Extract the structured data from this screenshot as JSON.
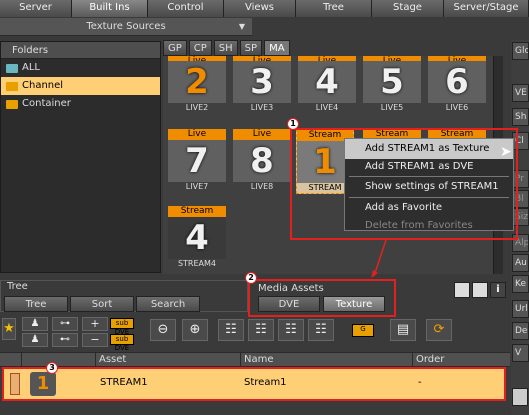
{
  "top_tabs": [
    "Server",
    "Built Ins",
    "Control",
    "Views",
    "Tree",
    "Stage",
    "Server/Stage"
  ],
  "panel": {
    "title": "Texture Sources"
  },
  "folders": {
    "header": "Folders",
    "items": [
      "ALL",
      "Channel",
      "Container"
    ]
  },
  "subtabs": [
    "GP",
    "CP",
    "SH",
    "SP",
    "MA"
  ],
  "assets": [
    {
      "label": "Live",
      "num": "2",
      "caption": "LIVE2",
      "orange": true
    },
    {
      "label": "Live",
      "num": "3",
      "caption": "LIVE3",
      "orange": false
    },
    {
      "label": "Live",
      "num": "4",
      "caption": "LIVE4",
      "orange": false
    },
    {
      "label": "Live",
      "num": "5",
      "caption": "LIVE5",
      "orange": false
    },
    {
      "label": "Live",
      "num": "6",
      "caption": "LIVE6",
      "orange": false
    },
    {
      "label": "Live",
      "num": "7",
      "caption": "LIVE7",
      "orange": false
    },
    {
      "label": "Live",
      "num": "8",
      "caption": "LIVE8",
      "orange": false
    },
    {
      "label": "Stream",
      "num": "1",
      "caption": "STREAM",
      "orange": true
    },
    {
      "label": "Stream",
      "num": "",
      "caption": "",
      "orange": false
    },
    {
      "label": "Stream",
      "num": "",
      "caption": "",
      "orange": false
    },
    {
      "label": "Stream",
      "num": "4",
      "caption": "STREAM4",
      "orange": false
    }
  ],
  "context_menu": {
    "items": [
      "Add STREAM1 as Texture",
      "Add STREAM1 as DVE",
      "Show settings of STREAM1",
      "Add as Favorite",
      "Delete from Favorites"
    ]
  },
  "tree": {
    "header": "Tree",
    "buttons": [
      "Tree",
      "Sort",
      "Search"
    ]
  },
  "media_assets": {
    "header": "Media Assets",
    "buttons": [
      "DVE",
      "Texture"
    ]
  },
  "callouts": [
    "1",
    "2",
    "3"
  ],
  "table": {
    "columns": [
      "Asset",
      "Name",
      "Order"
    ],
    "row": {
      "asset": "STREAM1",
      "name": "Stream1",
      "order": "-",
      "icon_num": "1"
    }
  },
  "right_panel": [
    "Glo",
    "VE",
    "Sh",
    "Cl",
    "Pr",
    "Bl",
    "Siz",
    "Alp",
    "Au",
    "Ke",
    "Url",
    "De",
    "V"
  ],
  "toolbar_small_labels": [
    "sub DVE",
    "sub DVE",
    "G"
  ],
  "colors": {
    "accent": "#f08c00",
    "selection": "#ffcf75",
    "callout": "#e32020"
  }
}
